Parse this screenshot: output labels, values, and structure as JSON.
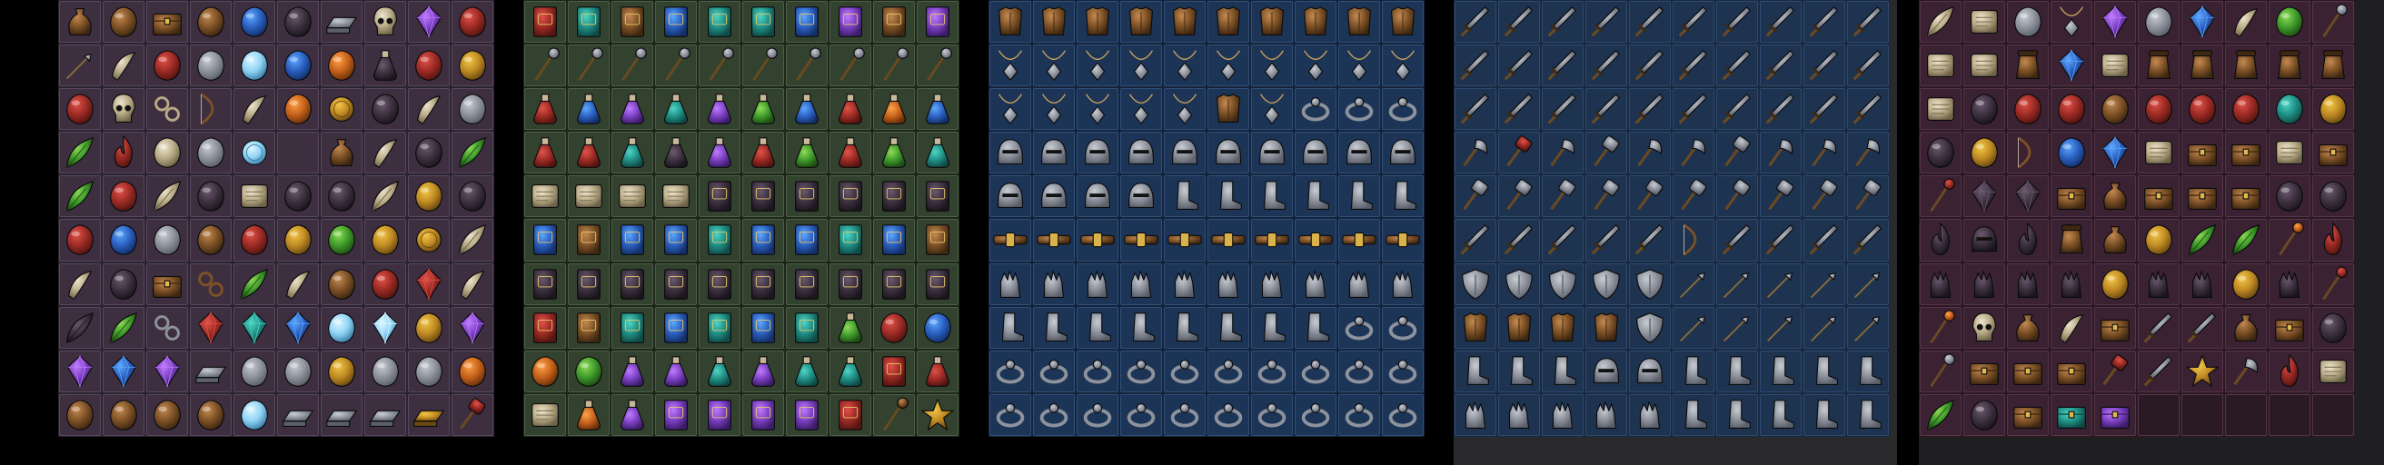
{
  "background_color": "#000000",
  "sheets": [
    {
      "id": "materials",
      "frame_color": "#2a2630",
      "slot_color": "#3e2f40",
      "slot_border": "#5a4660",
      "rows": [
        [
          "pouch",
          "acorn",
          "chestnut",
          "wood-log",
          "blue-orb",
          "mushroom",
          "iron-ingot",
          "skull",
          "crystal-cluster",
          "meat"
        ],
        [
          "arrow",
          "horn",
          "raw-steak",
          "silver-nugget",
          "salt",
          "glass-orb",
          "pumpkin",
          "bottle",
          "ham",
          "gold-lump"
        ],
        [
          "meat-chunk",
          "skull",
          "spider-web",
          "bow-string",
          "bone",
          "pumpkin",
          "gold-coin",
          "ash",
          "tooth",
          "rock"
        ],
        [
          "leaves",
          "fire-burst",
          "ribcage",
          "ore-lump",
          "silver-coin",
          "coil",
          "grain-sack",
          "horn",
          "branch",
          "herb"
        ],
        [
          "leaf",
          "red-orb",
          "feather",
          "raven",
          "scroll",
          "mushroom-cluster",
          "pile",
          "quill",
          "egg",
          "orb"
        ],
        [
          "salmon-egg",
          "blue-egg",
          "ore",
          "bread",
          "apple",
          "cheese",
          "melon",
          "egg",
          "coin-pile",
          "feather"
        ],
        [
          "fang",
          "nugget",
          "box",
          "rope",
          "pinecone",
          "claw",
          "nut",
          "brain",
          "ruby-ore",
          "tooth"
        ],
        [
          "wing",
          "pine-branch",
          "chain",
          "ruby",
          "emerald",
          "sapphire",
          "pearl",
          "diamond",
          "amber",
          "amethyst"
        ],
        [
          "ice-crystal",
          "ice-shard",
          "amethyst-cluster",
          "silver-bar",
          "ore",
          "silver-ore",
          "gold-ore",
          "coal",
          "rock-pile",
          "copper-ore"
        ],
        [
          "brown-ball",
          "sand",
          "seeds",
          "dust",
          "salt-pile",
          "iron-bar",
          "steel-bar",
          "silver-ingot",
          "gold-bar",
          "hammer"
        ]
      ]
    },
    {
      "id": "tomes-potions",
      "frame_color": "#1e261c",
      "slot_color": "#33422e",
      "slot_border": "#4c5f44",
      "rows": [
        [
          "red-tome",
          "teal-tome",
          "brown-tome",
          "blue-tome",
          "green-tome",
          "green-tome",
          "blue-tome",
          "purple-tome",
          "brown-tome",
          "purple-tome"
        ],
        [
          "wand",
          "rod",
          "staff",
          "scepter",
          "staff",
          "rod",
          "scepter",
          "wand",
          "staff",
          "wand"
        ],
        [
          "red-potion",
          "blue-potion",
          "purple-potion",
          "teal-potion",
          "purple-potion",
          "green-potion",
          "blue-potion",
          "red-potion",
          "orange-potion",
          "blue-potion"
        ],
        [
          "red-flask",
          "red-flask",
          "teal-flask",
          "yellow-flask",
          "purple-flask",
          "red-flask",
          "green-flask",
          "red-flask",
          "green-flask",
          "teal-flask"
        ],
        [
          "letter",
          "parchment",
          "scroll",
          "scroll",
          "tome",
          "tome",
          "rune-book",
          "rune-book",
          "spellbook",
          "spellbook"
        ],
        [
          "blue-tome",
          "brown-tome",
          "blue-tome",
          "blue-tome",
          "teal-tome",
          "blue-tome",
          "navy-tome",
          "teal-tome",
          "blue-tome",
          "brown-tome"
        ],
        [
          "tome",
          "tome",
          "tome",
          "tome",
          "tome",
          "tome",
          "tome",
          "tome",
          "tome",
          "tome"
        ],
        [
          "red-tome",
          "brown-tome",
          "teal-tome",
          "blue-tome",
          "teal-tome",
          "navy-tome",
          "green-tome",
          "green-potion",
          "red-orb",
          "blue-orb"
        ],
        [
          "orange-orb",
          "green-orb",
          "purple-potion",
          "purple-potion",
          "teal-potion",
          "purple-potion",
          "teal-potion",
          "teal-potion",
          "red-tome",
          "red-potion"
        ],
        [
          "scroll",
          "orange-potion",
          "purple-potion",
          "purple-tome",
          "purple-tome",
          "purple-tome",
          "purple-tome",
          "red-tome",
          "brown-rod",
          "star"
        ]
      ]
    },
    {
      "id": "armor",
      "frame_color": "#15243a",
      "slot_color": "#1c3456",
      "slot_border": "#2f4f7a",
      "rows": [
        [
          "chestplate",
          "chestplate",
          "chestplate",
          "chestplate",
          "chestplate",
          "chestplate",
          "chestplate",
          "chestplate",
          "chestplate",
          "chestplate"
        ],
        [
          "amulet",
          "amulet",
          "amulet",
          "amulet",
          "amulet",
          "amulet",
          "amulet",
          "amulet",
          "amulet",
          "amulet"
        ],
        [
          "amulet",
          "amulet",
          "amulet",
          "amulet",
          "amulet",
          "chestplate",
          "amulet",
          "ring",
          "ring",
          "ring"
        ],
        [
          "helmet",
          "helmet",
          "helmet",
          "helmet",
          "helmet",
          "helmet",
          "helmet",
          "helmet",
          "helmet",
          "helmet"
        ],
        [
          "helmet",
          "helmet",
          "helmet",
          "helmet",
          "boot",
          "boot",
          "boot",
          "boot",
          "boot",
          "boot"
        ],
        [
          "belt",
          "belt",
          "belt",
          "belt",
          "belt",
          "belt",
          "belt",
          "belt",
          "belt",
          "belt"
        ],
        [
          "gauntlet",
          "gauntlet",
          "gauntlet",
          "gauntlet",
          "gauntlet",
          "gauntlet",
          "gauntlet",
          "gauntlet",
          "gauntlet",
          "gauntlet"
        ],
        [
          "boot",
          "boot",
          "boot",
          "boot",
          "boot",
          "boot",
          "boot",
          "boot",
          "ring",
          "ring"
        ],
        [
          "ring",
          "ring",
          "ring",
          "ring",
          "ring",
          "ring",
          "ring",
          "ring",
          "ring",
          "ring"
        ],
        [
          "ring",
          "ring",
          "ring",
          "ring",
          "ring",
          "ring",
          "ring",
          "ring",
          "ring",
          "ring"
        ]
      ]
    },
    {
      "id": "weapons",
      "frame_color": "#1a2a40",
      "slot_color": "#1d3350",
      "slot_border": "#2e4a70",
      "rows": [
        [
          "sword",
          "sword",
          "sword",
          "sword",
          "sword",
          "sword",
          "dagger",
          "dagger",
          "dagger",
          "dagger"
        ],
        [
          "sword",
          "sword",
          "sword",
          "sword",
          "sword",
          "sword",
          "sword",
          "sword",
          "sword",
          "sword"
        ],
        [
          "sword",
          "sword",
          "sword",
          "sword",
          "sword",
          "sword",
          "sword",
          "sword",
          "sword",
          "sword"
        ],
        [
          "axe",
          "hammer",
          "axe",
          "mace",
          "axe",
          "axe",
          "mace",
          "axe",
          "axe",
          "axe"
        ],
        [
          "mace",
          "mace",
          "mace",
          "mace",
          "mace",
          "mace",
          "mace",
          "mace",
          "mace",
          "mace"
        ],
        [
          "dagger",
          "dagger",
          "scimitar",
          "scimitar",
          "scimitar",
          "bow",
          "scimitar",
          "scimitar",
          "scimitar",
          "scimitar"
        ],
        [
          "shield",
          "shield",
          "shield",
          "shield",
          "shield",
          "arrow",
          "arrow",
          "arrow",
          "arrow",
          "arrow"
        ],
        [
          "cloak",
          "cloak",
          "cloak",
          "cloak",
          "shield",
          "arrow",
          "arrow",
          "arrow",
          "arrow",
          "arrow"
        ],
        [
          "greaves",
          "greaves",
          "greaves",
          "helmet",
          "helmet",
          "greaves",
          "greaves",
          "greaves",
          "greaves",
          "greaves"
        ],
        [
          "gauntlet",
          "gauntlet",
          "gauntlet",
          "gauntlet",
          "gauntlet",
          "boot",
          "boot",
          "boot",
          "boot",
          "boot"
        ]
      ]
    },
    {
      "id": "misc",
      "frame_color": "#2a1a24",
      "slot_color": "#3a2232",
      "slot_border": "#573447",
      "rows": [
        [
          "quill",
          "scroll",
          "tool",
          "amulet",
          "crystal",
          "tool",
          "dice",
          "fang",
          "fruit",
          "wand"
        ],
        [
          "map",
          "scroll",
          "jar",
          "dice",
          "map",
          "jar",
          "jar",
          "jar",
          "jar",
          "jar"
        ],
        [
          "map",
          "orb",
          "apple",
          "meat",
          "bread",
          "apple",
          "meat",
          "apple",
          "lime",
          "smiley"
        ],
        [
          "gift",
          "sun-orb",
          "bowl",
          "blue-orb",
          "ice-orb",
          "parchment",
          "chest",
          "box",
          "map",
          "chest"
        ],
        [
          "fire-wand",
          "gem",
          "gem",
          "chest",
          "bag",
          "box",
          "box",
          "chest",
          "pig",
          "pig"
        ],
        [
          "flag",
          "mask",
          "banner",
          "pot",
          "bag",
          "gold",
          "leaf",
          "leaf",
          "torch",
          "fire"
        ],
        [
          "glove",
          "glove",
          "glove",
          "glove",
          "gold",
          "glove",
          "glove",
          "gold",
          "glove",
          "fire-torch"
        ],
        [
          "torch",
          "skull",
          "pouch",
          "horn",
          "box",
          "sword",
          "sword",
          "pouch",
          "box",
          "orb"
        ],
        [
          "staff",
          "box",
          "box",
          "box",
          "hammer",
          "sword",
          "star",
          "axe",
          "fire",
          "scroll"
        ],
        [
          "plant",
          "beast",
          "tablet",
          "teal-chest",
          "purple-box",
          "empty",
          "empty",
          "empty",
          "empty",
          "empty"
        ]
      ]
    }
  ]
}
